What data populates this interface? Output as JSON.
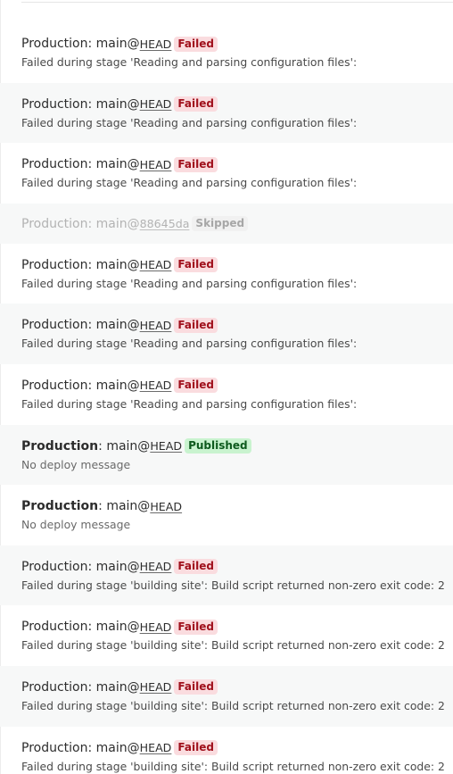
{
  "deploys": [
    {
      "env": "Production",
      "branch": "main@",
      "ref": "HEAD",
      "status": "Failed",
      "message": "Failed during stage 'Reading and parsing configuration files':"
    },
    {
      "env": "Production",
      "branch": "main@",
      "ref": "HEAD",
      "status": "Failed",
      "message": "Failed during stage 'Reading and parsing configuration files':"
    },
    {
      "env": "Production",
      "branch": "main@",
      "ref": "HEAD",
      "status": "Failed",
      "message": "Failed during stage 'Reading and parsing configuration files':"
    },
    {
      "env": "Production",
      "branch": "main@",
      "ref": "88645da",
      "status": "Skipped",
      "message": ""
    },
    {
      "env": "Production",
      "branch": "main@",
      "ref": "HEAD",
      "status": "Failed",
      "message": "Failed during stage 'Reading and parsing configuration files':"
    },
    {
      "env": "Production",
      "branch": "main@",
      "ref": "HEAD",
      "status": "Failed",
      "message": "Failed during stage 'Reading and parsing configuration files':"
    },
    {
      "env": "Production",
      "branch": "main@",
      "ref": "HEAD",
      "status": "Failed",
      "message": "Failed during stage 'Reading and parsing configuration files':"
    },
    {
      "env": "Production",
      "branch": "main@",
      "ref": "HEAD",
      "status": "Published",
      "message": "No deploy message"
    },
    {
      "env": "Production",
      "branch": "main@",
      "ref": "HEAD",
      "status": "",
      "message": "No deploy message"
    },
    {
      "env": "Production",
      "branch": "main@",
      "ref": "HEAD",
      "status": "Failed",
      "message": "Failed during stage 'building site': Build script returned non-zero exit code: 2"
    },
    {
      "env": "Production",
      "branch": "main@",
      "ref": "HEAD",
      "status": "Failed",
      "message": "Failed during stage 'building site': Build script returned non-zero exit code: 2"
    },
    {
      "env": "Production",
      "branch": "main@",
      "ref": "HEAD",
      "status": "Failed",
      "message": "Failed during stage 'building site': Build script returned non-zero exit code: 2"
    },
    {
      "env": "Production",
      "branch": "main@",
      "ref": "HEAD",
      "status": "Failed",
      "message": "Failed during stage 'building site': Build script returned non-zero exit code: 2"
    }
  ]
}
